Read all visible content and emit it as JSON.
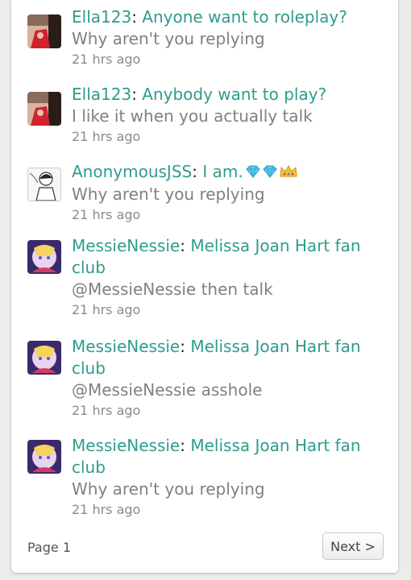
{
  "feed": [
    {
      "author": "Ella123",
      "title": "Anyone want to roleplay?",
      "message": "Why aren't you replying",
      "time": "21 hrs ago",
      "avatar_icon": "ella-avatar-icon"
    },
    {
      "author": "Ella123",
      "title": "Anybody want to play?",
      "message": "I like it when you actually talk",
      "time": "21 hrs ago",
      "avatar_icon": "ella-avatar-icon"
    },
    {
      "author": "AnonymousJSS",
      "title": "I am.",
      "message": "Why aren't you replying",
      "time": "21 hrs ago",
      "avatar_icon": "anonymous-avatar-icon",
      "badges": [
        "diamond-icon",
        "diamond-icon",
        "crown-icon"
      ]
    },
    {
      "author": "MessieNessie",
      "title": "Melissa Joan Hart fan club",
      "message": "@MessieNessie then talk",
      "time": "21 hrs ago",
      "avatar_icon": "messie-avatar-icon"
    },
    {
      "author": "MessieNessie",
      "title": "Melissa Joan Hart fan club",
      "message": "@MessieNessie asshole",
      "time": "21 hrs ago",
      "avatar_icon": "messie-avatar-icon"
    },
    {
      "author": "MessieNessie",
      "title": "Melissa Joan Hart fan club",
      "message": "Why aren't you replying",
      "time": "21 hrs ago",
      "avatar_icon": "messie-avatar-icon"
    }
  ],
  "pagination": {
    "page_label": "Page 1",
    "next_label": "Next >"
  },
  "colors": {
    "link": "#2e9c8c",
    "message": "#808080",
    "background": "#ececec"
  }
}
